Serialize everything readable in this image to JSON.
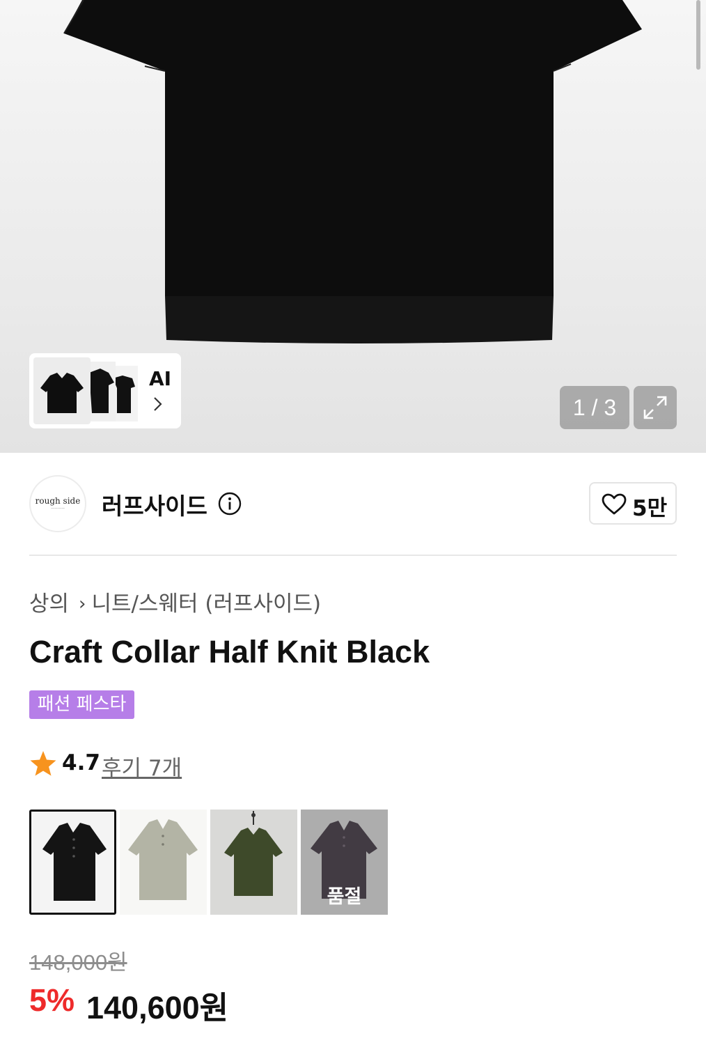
{
  "gallery": {
    "counter": "1 / 3",
    "ai_label": "AI",
    "icons": {
      "expand": "expand-icon",
      "ai_next": "chevron-right-icon"
    }
  },
  "brand": {
    "name": "러프사이드",
    "logo_text": "rough side",
    "like_count": "5만",
    "icons": {
      "info": "info-icon",
      "like": "heart-icon"
    }
  },
  "breadcrumb": {
    "items": [
      "상의",
      "니트/스웨터 (러프사이드)"
    ],
    "separator": "›"
  },
  "product": {
    "title": "Craft Collar Half Knit Black",
    "badge": "패션 페스타",
    "rating": "4.7",
    "review_link": "후기 7개"
  },
  "colors": [
    {
      "name": "black",
      "hex": "#141414",
      "selected": true,
      "sold_out": false
    },
    {
      "name": "sage",
      "hex": "#b3b4a5",
      "selected": false,
      "sold_out": false
    },
    {
      "name": "khaki",
      "hex": "#3e4a2a",
      "selected": false,
      "sold_out": false
    },
    {
      "name": "purple",
      "hex": "#2e2230",
      "selected": false,
      "sold_out": true,
      "label": "품절"
    }
  ],
  "price": {
    "original": "148,000원",
    "discount": "5%",
    "final": "140,600원"
  },
  "theme": {
    "badge_color": "#b67ee8",
    "discount_color": "#ee2b2b",
    "rating_star_color": "#f7931e"
  }
}
